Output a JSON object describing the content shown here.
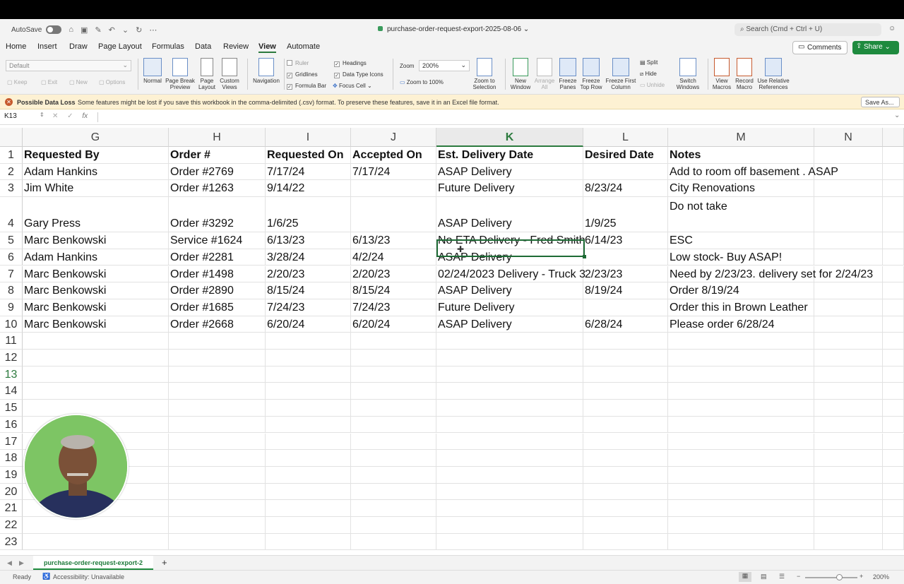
{
  "titlebar": {
    "autosave_label": "AutoSave",
    "doc_title": "purchase-order-request-export-2025-08-06",
    "search_placeholder": "Search (Cmd + Ctrl + U)"
  },
  "menu": {
    "items": [
      "Home",
      "Insert",
      "Draw",
      "Page Layout",
      "Formulas",
      "Data",
      "Review",
      "View",
      "Automate"
    ],
    "active": "View",
    "comments_label": "Comments",
    "share_label": "Share"
  },
  "ribbon": {
    "sheet_view_select": "Default",
    "sheet_view_actions": [
      "Keep",
      "Exit",
      "New",
      "Options"
    ],
    "workbook_views": [
      "Normal",
      "Page Break Preview",
      "Page Layout",
      "Custom Views"
    ],
    "navigation_label": "Navigation",
    "show_checks": [
      {
        "label": "Ruler",
        "checked": false
      },
      {
        "label": "Gridlines",
        "checked": true
      },
      {
        "label": "Formula Bar",
        "checked": true
      },
      {
        "label": "Headings",
        "checked": true
      },
      {
        "label": "Data Type Icons",
        "checked": true
      }
    ],
    "focus_cell_label": "Focus Cell",
    "zoom_label": "Zoom",
    "zoom_value": "200%",
    "zoom_100_label": "Zoom to 100%",
    "zoom_selection_label": "Zoom to Selection",
    "window_buttons": [
      "New Window",
      "Arrange All",
      "Freeze Panes",
      "Freeze Top Row",
      "Freeze First Column"
    ],
    "split_label": "Split",
    "hide_label": "Hide",
    "unhide_label": "Unhide",
    "switch_windows_label": "Switch Windows",
    "macro_buttons": [
      "View Macros",
      "Record Macro",
      "Use Relative References"
    ]
  },
  "infobar": {
    "title": "Possible Data Loss",
    "message": "Some features might be lost if you save this workbook in the comma-delimited (.csv) format. To preserve these features, save it in an Excel file format.",
    "save_as_label": "Save As..."
  },
  "formula_bar": {
    "name_box": "K13",
    "fx_label": "fx",
    "content": ""
  },
  "sheet": {
    "columns": [
      "G",
      "H",
      "I",
      "J",
      "K",
      "L",
      "M",
      "N"
    ],
    "selected_column": "K",
    "row_numbers": [
      "1",
      "2",
      "3",
      "4",
      "5",
      "6",
      "7",
      "8",
      "9",
      "10",
      "11",
      "12",
      "13",
      "14",
      "15",
      "16",
      "17",
      "18",
      "19",
      "20",
      "21",
      "22",
      "23"
    ],
    "selected_row": "13",
    "rows": [
      [
        "Requested By",
        "Order #",
        "Requested On",
        "Accepted On",
        "Est. Delivery Date",
        "Desired Date",
        "Notes",
        ""
      ],
      [
        "Adam Hankins",
        "Order #2769",
        "7/17/24",
        "7/17/24",
        "ASAP Delivery",
        "",
        "Add to room off basement .  ASAP",
        ""
      ],
      [
        "Jim White",
        "Order #1263",
        "9/14/22",
        "",
        "Future Delivery",
        "8/23/24",
        "City Renovations",
        ""
      ],
      [
        "Gary Press",
        "Order #3292",
        "1/6/25",
        "",
        "ASAP Delivery",
        "1/9/25",
        "Do not take",
        ""
      ],
      [
        "Marc Benkowski",
        "Service #1624",
        "6/13/23",
        "6/13/23",
        "No ETA Delivery - Fred Smith",
        "6/14/23",
        "ESC",
        ""
      ],
      [
        "Adam Hankins",
        "Order #2281",
        "3/28/24",
        "4/2/24",
        "ASAP Delivery",
        "",
        "Low stock-  Buy ASAP!",
        ""
      ],
      [
        "Marc Benkowski",
        "Order #1498",
        "2/20/23",
        "2/20/23",
        "02/24/2023 Delivery - Truck 3",
        "2/23/23",
        "Need by 2/23/23. delivery set for 2/24/23",
        ""
      ],
      [
        "Marc Benkowski",
        "Order #2890",
        "8/15/24",
        "8/15/24",
        "ASAP Delivery",
        "8/19/24",
        "Order 8/19/24",
        ""
      ],
      [
        "Marc Benkowski",
        "Order #1685",
        "7/24/23",
        "7/24/23",
        "Future Delivery",
        "",
        "Order this in Brown Leather",
        ""
      ],
      [
        "Marc Benkowski",
        "Order #2668",
        "6/20/24",
        "6/20/24",
        "ASAP Delivery",
        "6/28/24",
        "Please order 6/28/24",
        ""
      ]
    ]
  },
  "sheet_tab": "purchase-order-request-export-2",
  "status": {
    "ready": "Ready",
    "accessibility": "Accessibility: Unavailable",
    "zoom": "200%"
  }
}
